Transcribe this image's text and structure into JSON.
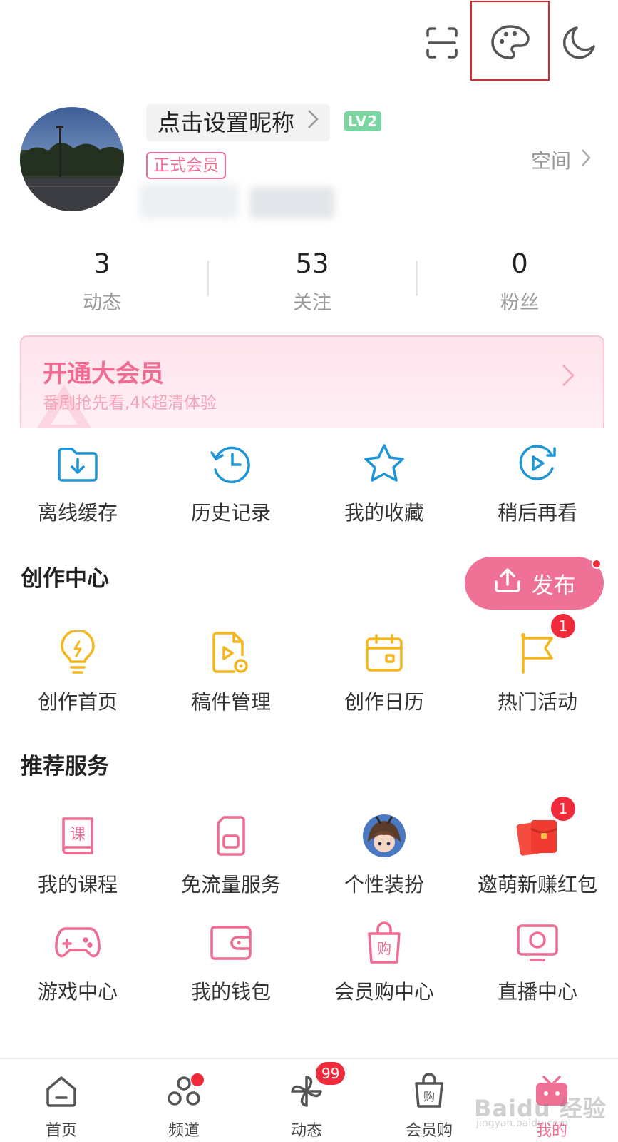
{
  "profile": {
    "nickname_prompt": "点击设置昵称",
    "level_badge": "LV2",
    "member_tag": "正式会员",
    "space_link": "空间"
  },
  "stats": [
    {
      "value": "3",
      "label": "动态"
    },
    {
      "value": "53",
      "label": "关注"
    },
    {
      "value": "0",
      "label": "粉丝"
    }
  ],
  "vip_banner": {
    "title": "开通大会员",
    "subtitle": "番剧抢先看,4K超清体验"
  },
  "quick_actions": [
    {
      "label": "离线缓存",
      "icon": "download-folder-icon"
    },
    {
      "label": "历史记录",
      "icon": "history-clock-icon"
    },
    {
      "label": "我的收藏",
      "icon": "star-icon"
    },
    {
      "label": "稍后再看",
      "icon": "watch-later-icon"
    }
  ],
  "creation_center": {
    "title": "创作中心",
    "publish_label": "发布",
    "items": [
      {
        "label": "创作首页",
        "icon": "lightbulb-icon"
      },
      {
        "label": "稿件管理",
        "icon": "manuscript-icon"
      },
      {
        "label": "创作日历",
        "icon": "calendar-icon"
      },
      {
        "label": "热门活动",
        "icon": "flag-icon",
        "badge": "1"
      }
    ]
  },
  "services": {
    "title": "推荐服务",
    "items": [
      {
        "label": "我的课程",
        "icon": "course-book-icon"
      },
      {
        "label": "免流量服务",
        "icon": "sim-card-icon"
      },
      {
        "label": "个性装扮",
        "icon": "anime-avatar-icon"
      },
      {
        "label": "邀萌新赚红包",
        "icon": "red-envelope-icon",
        "badge": "1"
      },
      {
        "label": "游戏中心",
        "icon": "gamepad-icon"
      },
      {
        "label": "我的钱包",
        "icon": "wallet-icon"
      },
      {
        "label": "会员购中心",
        "icon": "shopping-bag-icon"
      },
      {
        "label": "直播中心",
        "icon": "live-tv-icon"
      }
    ]
  },
  "tabbar": [
    {
      "label": "首页",
      "icon": "home-icon"
    },
    {
      "label": "频道",
      "icon": "channel-icon"
    },
    {
      "label": "动态",
      "icon": "pinwheel-icon",
      "badge": "99"
    },
    {
      "label": "会员购",
      "icon": "shopping-bag-icon"
    },
    {
      "label": "我的",
      "icon": "tv-mascot-icon",
      "active": true
    }
  ],
  "watermark": {
    "text": "Baidu 经验",
    "sub": "jingyan.baidu.com"
  },
  "colors": {
    "accent": "#f07196",
    "creation": "#f4b51d",
    "blue": "#1e96d6",
    "badge": "#ee2a3b"
  }
}
